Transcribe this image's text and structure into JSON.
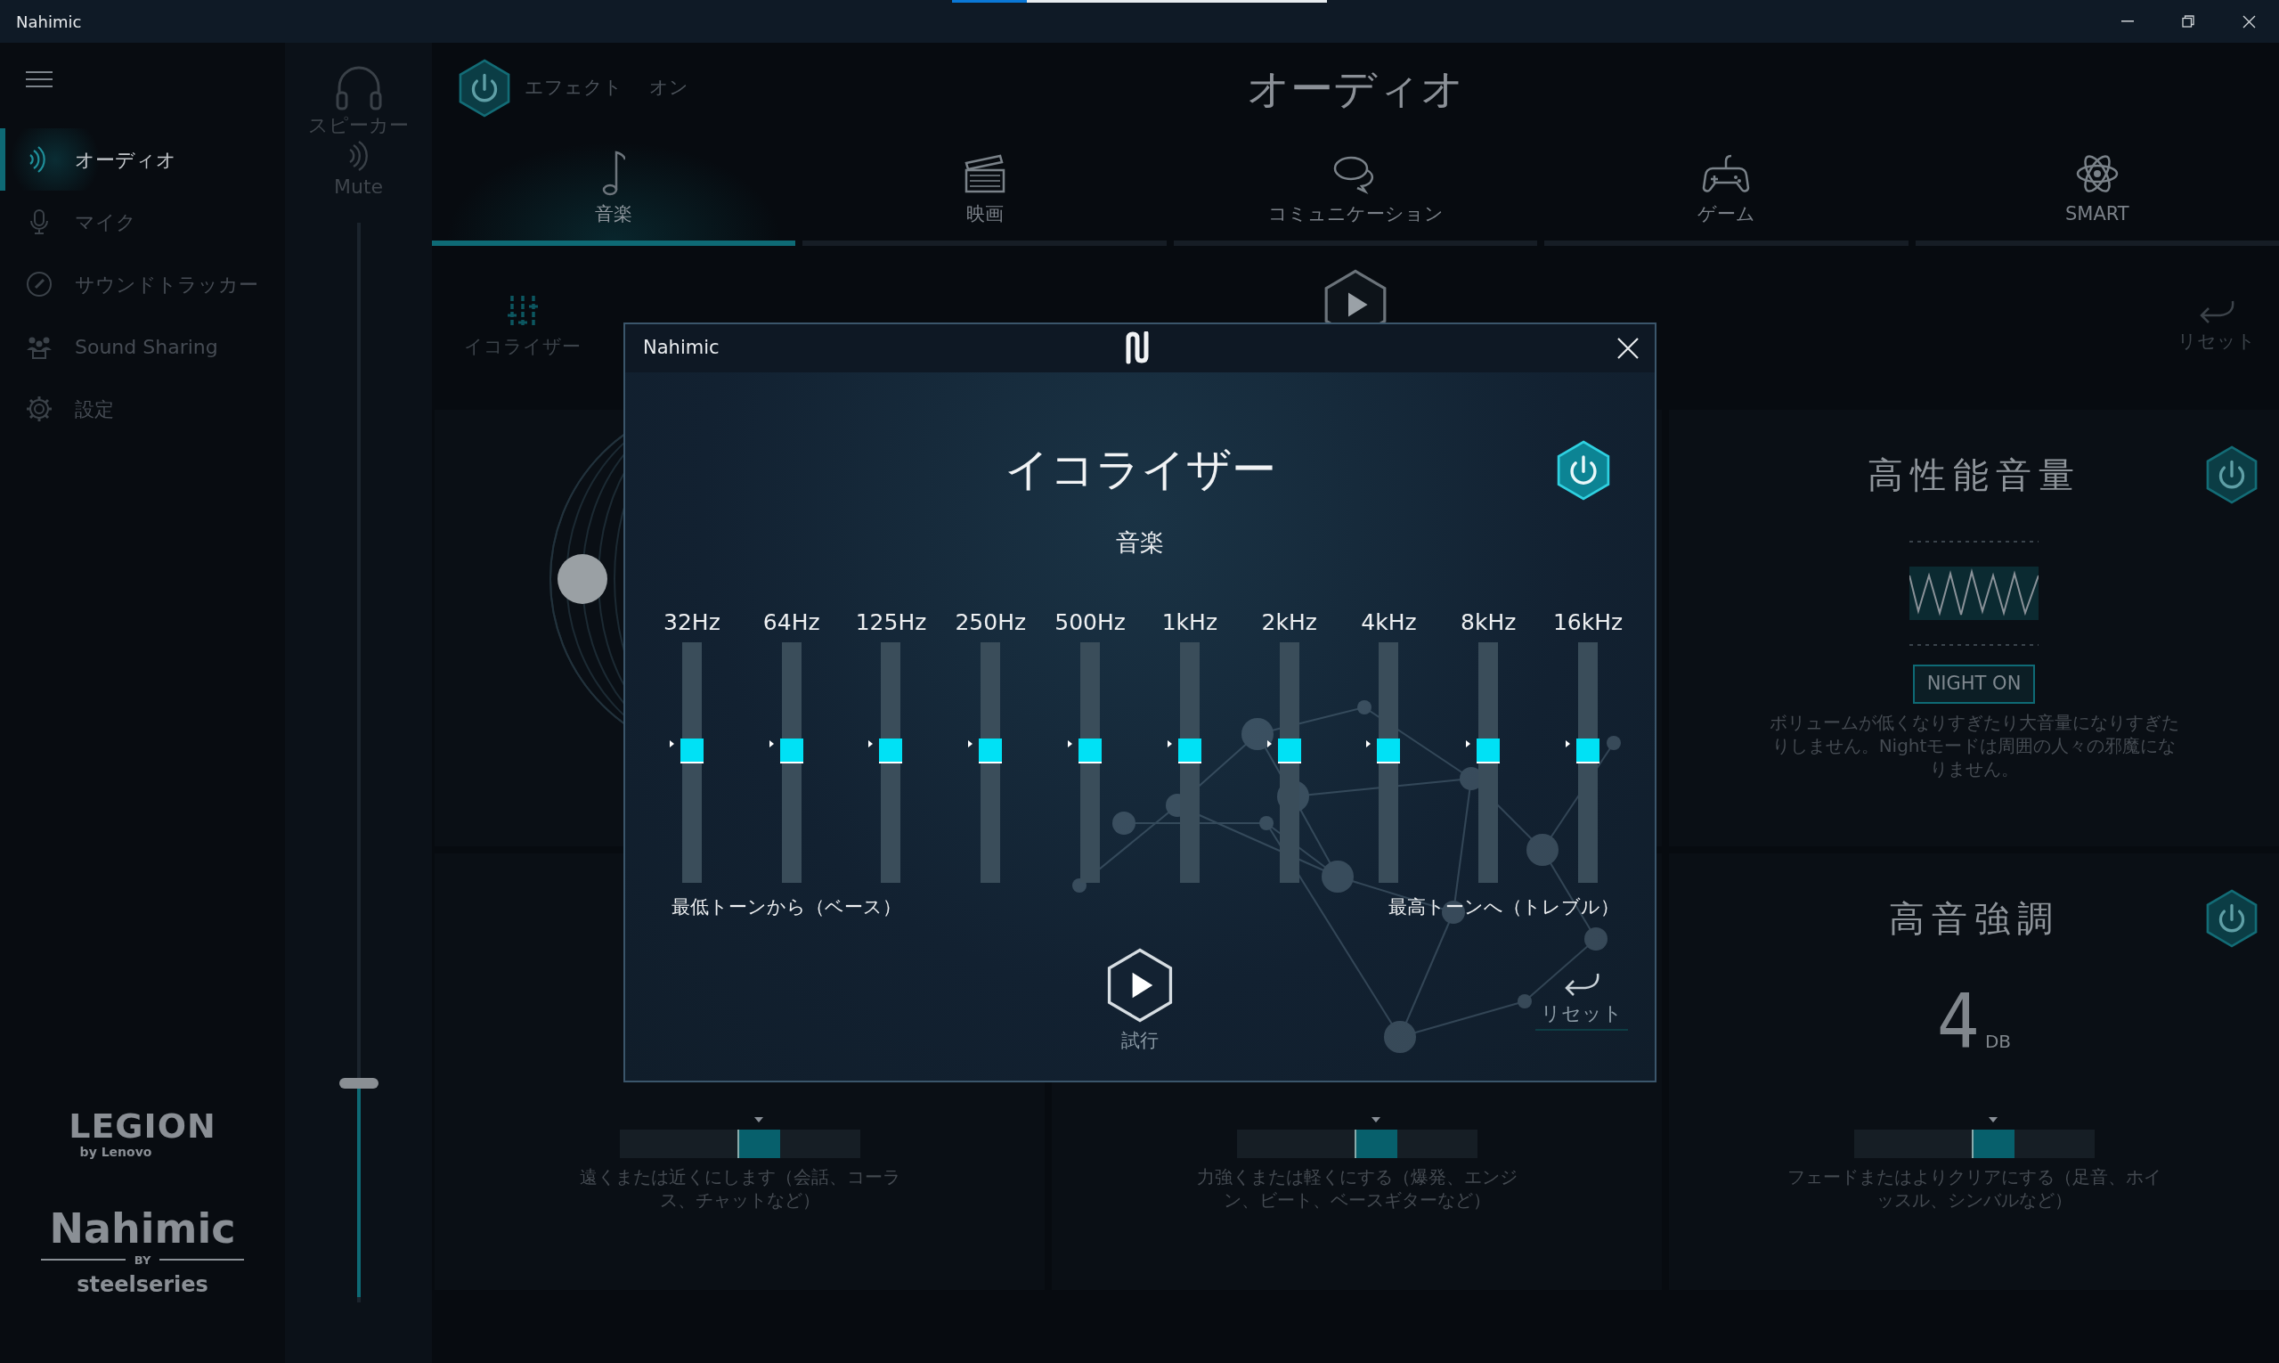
{
  "window": {
    "title": "Nahimic",
    "loading": {
      "level": 0.2
    }
  },
  "sidebar": {
    "items": [
      {
        "label": "オーディオ",
        "selected": true
      },
      {
        "label": "マイク",
        "selected": false
      },
      {
        "label": "サウンドトラッカー",
        "selected": false
      },
      {
        "label": "Sound Sharing",
        "selected": false
      },
      {
        "label": "設定",
        "selected": false
      }
    ]
  },
  "logos": {
    "legion": "LEGION",
    "legion_by": "by Lenovo",
    "nahimic": "Nahimic",
    "nahimic_by": "BY",
    "steelseries": "steelseries"
  },
  "device": {
    "name": "スピーカー",
    "mute_label": "Mute",
    "volume": {
      "level": 0.2
    }
  },
  "header": {
    "effect": {
      "on": true,
      "label": "エフェクト",
      "state_label": "オン"
    },
    "title": "オーディオ"
  },
  "tabs": [
    {
      "label": "音楽",
      "selected": true
    },
    {
      "label": "映画",
      "selected": false
    },
    {
      "label": "コミュニケーション",
      "selected": false
    },
    {
      "label": "ゲーム",
      "selected": false
    },
    {
      "label": "SMART",
      "selected": false
    }
  ],
  "toolbar": {
    "equalizer": "イコライザー",
    "reset": "リセット"
  },
  "night_card": {
    "title": "高性能音量",
    "on": true,
    "button": "NIGHT ON",
    "description": "ボリュームが低くなりすぎたり大音量になりすぎたりしません。Nightモードは周囲の人々の邪魔になりません。"
  },
  "slider_cards": [
    {
      "level": 0.58,
      "description": "遠くまたは近くにします（会話、コーラス、チャットなど）"
    },
    {
      "level": 0.58,
      "description": "力強くまたは軽くにする（爆発、エンジン、ビート、ベースギターなど）"
    }
  ],
  "treble_card": {
    "title": "高音強調",
    "on": true,
    "value": "4",
    "unit": "DB",
    "level": 0.58,
    "description": "フェードまたはよりクリアにする（足音、ホイッスル、シンバルなど）"
  },
  "dialog": {
    "title": "Nahimic",
    "heading": "イコライザー",
    "on": true,
    "preset": "音楽",
    "bands": [
      {
        "label": "32Hz",
        "level": 0.55
      },
      {
        "label": "64Hz",
        "level": 0.55
      },
      {
        "label": "125Hz",
        "level": 0.55
      },
      {
        "label": "250Hz",
        "level": 0.55
      },
      {
        "label": "500Hz",
        "level": 0.55
      },
      {
        "label": "1kHz",
        "level": 0.55
      },
      {
        "label": "2kHz",
        "level": 0.55
      },
      {
        "label": "4kHz",
        "level": 0.55
      },
      {
        "label": "8kHz",
        "level": 0.55
      },
      {
        "label": "16kHz",
        "level": 0.55
      }
    ],
    "low_label": "最低トーンから（ベース）",
    "high_label": "最高トーンへ（トレブル）",
    "play_label": "試行",
    "reset_label": "リセット"
  }
}
